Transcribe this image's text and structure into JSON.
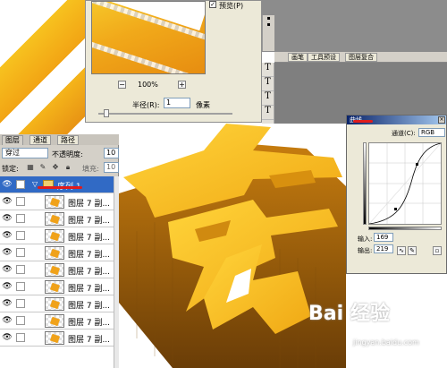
{
  "blur_dialog": {
    "preview_checkbox_label": "预览(P)",
    "preview_checked": "✓",
    "zoom_minus": "−",
    "zoom_plus": "+",
    "zoom_level": "100%",
    "radius_label": "半径(R):",
    "radius_value": "1",
    "radius_unit": "像素"
  },
  "palette_tabs": [
    "画笔",
    "工具预设",
    "图层复合"
  ],
  "char_buttons": [
    "T",
    "T",
    "T",
    "T"
  ],
  "curves_dialog": {
    "title": "曲线",
    "channel_label": "通道(C):",
    "channel_value": "RGB",
    "input_label": "输入:",
    "input_value": "169",
    "output_label": "输出:",
    "output_value": "219"
  },
  "layers_panel": {
    "tabs": [
      "图层",
      "通道",
      "路径"
    ],
    "blend_mode": "穿过",
    "opacity_label": "不透明度:",
    "opacity_value": "10",
    "lock_label": "锁定:",
    "fill_label": "填充:",
    "fill_value": "10",
    "group_name": "序列 1",
    "layers": [
      "图层 7 副...",
      "图层 7 副...",
      "图层 7 副...",
      "图层 7 副...",
      "图层 7 副...",
      "图层 7 副...",
      "图层 7 副...",
      "图层 7 副...",
      "图层 7 副..."
    ]
  },
  "watermark": {
    "brand": "Bai 经验",
    "url": "jingyan.baidu.com"
  },
  "colors": {
    "gold_light": "#f6c628",
    "gold_dark": "#e78d10",
    "selection_blue": "#316ac5",
    "highlight_red": "#e01c1c"
  }
}
